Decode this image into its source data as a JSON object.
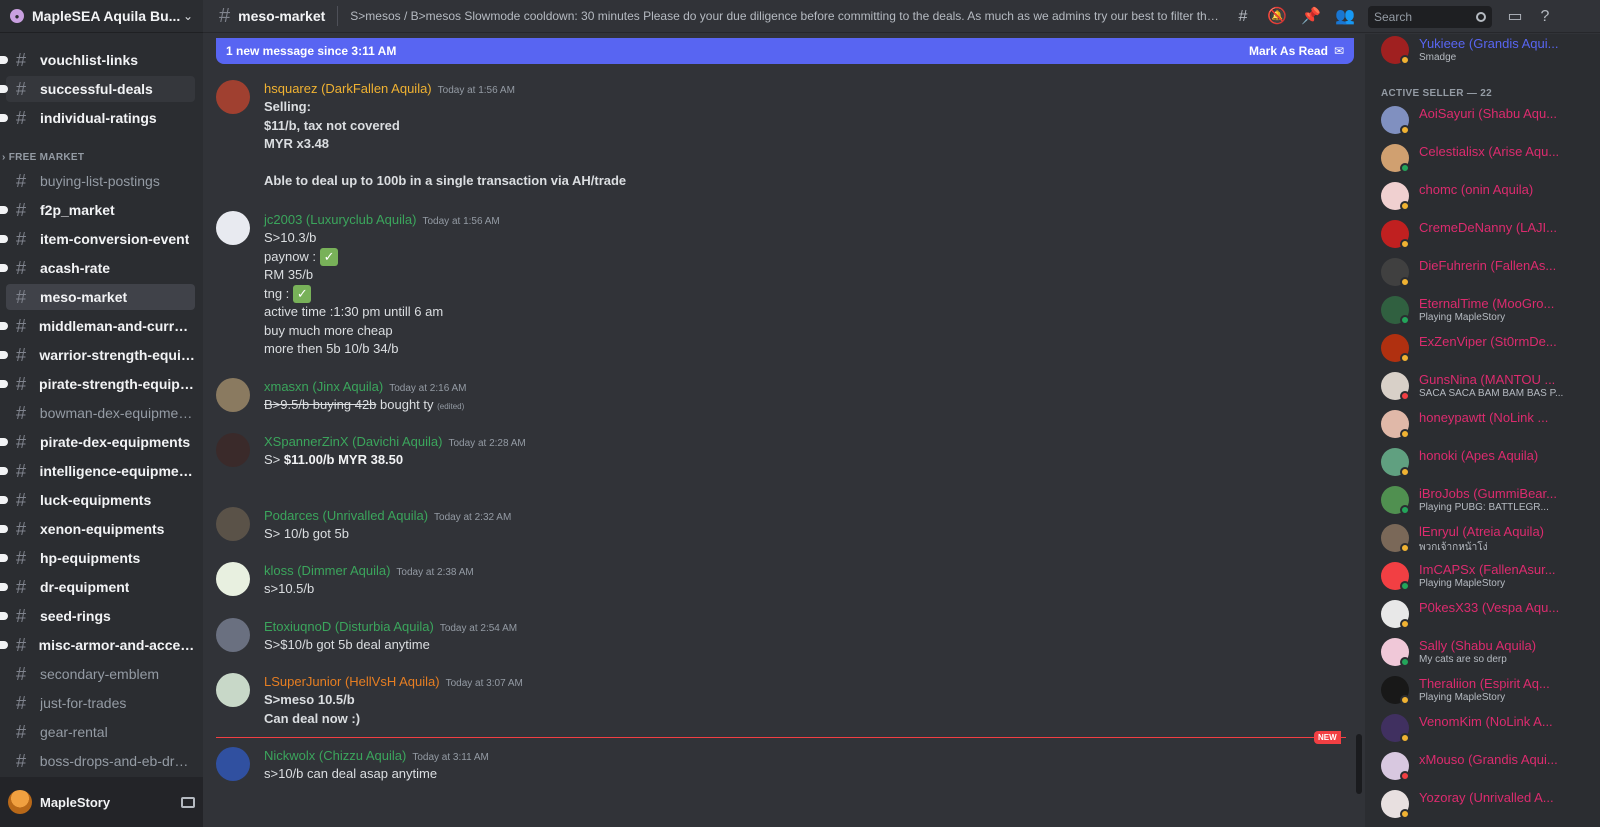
{
  "server": {
    "name": "MapleSEA Aquila Bu..."
  },
  "sidebar": {
    "category_free_market": "FREE MARKET",
    "channels": [
      {
        "label": "vouchlist-links"
      },
      {
        "label": "successful-deals"
      },
      {
        "label": "individual-ratings"
      },
      {
        "label": "buying-list-postings"
      },
      {
        "label": "f2p_market"
      },
      {
        "label": "item-conversion-event"
      },
      {
        "label": "acash-rate"
      },
      {
        "label": "meso-market"
      },
      {
        "label": "middleman-and-currency"
      },
      {
        "label": "warrior-strength-equip..."
      },
      {
        "label": "pirate-strength-equipm..."
      },
      {
        "label": "bowman-dex-equipments"
      },
      {
        "label": "pirate-dex-equipments"
      },
      {
        "label": "intelligence-equipments"
      },
      {
        "label": "luck-equipments"
      },
      {
        "label": "xenon-equipments"
      },
      {
        "label": "hp-equipments"
      },
      {
        "label": "dr-equipment"
      },
      {
        "label": "seed-rings"
      },
      {
        "label": "misc-armor-and-access..."
      },
      {
        "label": "secondary-emblem"
      },
      {
        "label": "just-for-trades"
      },
      {
        "label": "gear-rental"
      },
      {
        "label": "boss-drops-and-eb-drops"
      }
    ]
  },
  "user": {
    "name": "MapleStory"
  },
  "topbar": {
    "channel": "meso-market",
    "topic": "S>mesos / B>mesos Slowmode cooldown: 30 minutes Please do your due diligence before committing to the deals. As much as we admins try our best to filter the crowd,...",
    "search_placeholder": "Search"
  },
  "chat": {
    "new_since": "1 new message since 3:11 AM",
    "mark_read": "Mark As Read",
    "new_tag": "NEW",
    "messages": [
      {
        "user": "hsquarez (DarkFallen Aquila)",
        "time": "Today at 1:56 AM",
        "color": "#f0b232",
        "lines": [
          "Selling:",
          "$11/b, tax not covered",
          "MYR x3.48",
          "",
          "Able to deal up to 100b in a single transaction via AH/trade"
        ]
      },
      {
        "user": "jc2003 (Luxuryclub Aquila)",
        "time": "Today at 1:56 AM",
        "color": "#3ba55c",
        "lines": [
          "S>10.3/b",
          "paynow :",
          "RM 35/b",
          "tng :",
          "active time :1:30 pm untill 6 am",
          "buy much more cheap",
          "more then 5b  10/b   34/b"
        ]
      },
      {
        "user": "xmasxn (Jinx Aquila)",
        "time": "Today at 2:16 AM",
        "color": "#3ba55c",
        "struck": "B>9.5/b buying 42b",
        "rest": " bought ty",
        "edited": "(edited)"
      },
      {
        "user": "XSpannerZinX (Davichi Aquila)",
        "time": "Today at 2:28 AM",
        "color": "#3ba55c",
        "prefix": "S> ",
        "bold": "$11.00/b MYR 38.50"
      },
      {
        "user": "Podarces (Unrivalled Aquila)",
        "time": "Today at 2:32 AM",
        "color": "#3ba55c",
        "lines": [
          "S> 10/b got 5b"
        ]
      },
      {
        "user": "kloss (Dimmer Aquila)",
        "time": "Today at 2:38 AM",
        "color": "#3ba55c",
        "lines": [
          "s>10.5/b"
        ]
      },
      {
        "user": "EtoxiuqnoD (Disturbia Aquila)",
        "time": "Today at 2:54 AM",
        "color": "#3ba55c",
        "lines": [
          "S>$10/b got 5b deal anytime"
        ]
      },
      {
        "user": "LSuperJunior (HellVsH Aquila)",
        "time": "Today at 3:07 AM",
        "color": "#e67e22",
        "lines": [
          "S>meso 10.5/b",
          "Can deal now :)"
        ]
      },
      {
        "user": "Nickwolx (Chizzu Aquila)",
        "time": "Today at 3:11 AM",
        "color": "#3ba55c",
        "lines": [
          "s>10/b can deal asap anytime"
        ]
      }
    ]
  },
  "members": {
    "top": {
      "name": "Yukieee (Grandis Aqui...",
      "status": "Smadge"
    },
    "section": "ACTIVE SELLER — 22",
    "list": [
      {
        "name": "AoiSayuri (Shabu Aqu...",
        "status": ""
      },
      {
        "name": "Celestialisx (Arise Aqu...",
        "status": ""
      },
      {
        "name": "chomc (onin Aquila)",
        "status": ""
      },
      {
        "name": "CremeDeNanny (LAJI...",
        "status": ""
      },
      {
        "name": "DieFuhrerin (FallenAs...",
        "status": ""
      },
      {
        "name": "EternalTime (MooGro...",
        "status": "Playing MapleStory"
      },
      {
        "name": "ExZenViper (St0rmDe...",
        "status": ""
      },
      {
        "name": "GunsNina (MANTOU ...",
        "status": "SACA SACA BAM BAM BAS P..."
      },
      {
        "name": "honeypawtt (NoLink ...",
        "status": ""
      },
      {
        "name": "honoki (Apes Aquila)",
        "status": ""
      },
      {
        "name": "iBroJobs (GummiBear...",
        "status": "Playing PUBG: BATTLEGR..."
      },
      {
        "name": "lEnryul (Atreia Aquila)",
        "status": "พวกเจ้ากหน้าโง่"
      },
      {
        "name": "ImCAPSx (FallenAsur...",
        "status": "Playing MapleStory"
      },
      {
        "name": "P0kesX33 (Vespa Aqu...",
        "status": ""
      },
      {
        "name": "Sally (Shabu Aquila)",
        "status": "My cats are so derp"
      },
      {
        "name": "Theraliion (Espirit Aq...",
        "status": "Playing MapleStory"
      },
      {
        "name": "VenomKim (NoLink A...",
        "status": ""
      },
      {
        "name": "xMouso (Grandis Aqui...",
        "status": ""
      },
      {
        "name": "Yozoray (Unrivalled A...",
        "status": ""
      }
    ]
  },
  "colors": {
    "seller_name": "#dc2b6e",
    "online": "#23a55a",
    "idle": "#f0b232",
    "dnd": "#f23f43"
  }
}
